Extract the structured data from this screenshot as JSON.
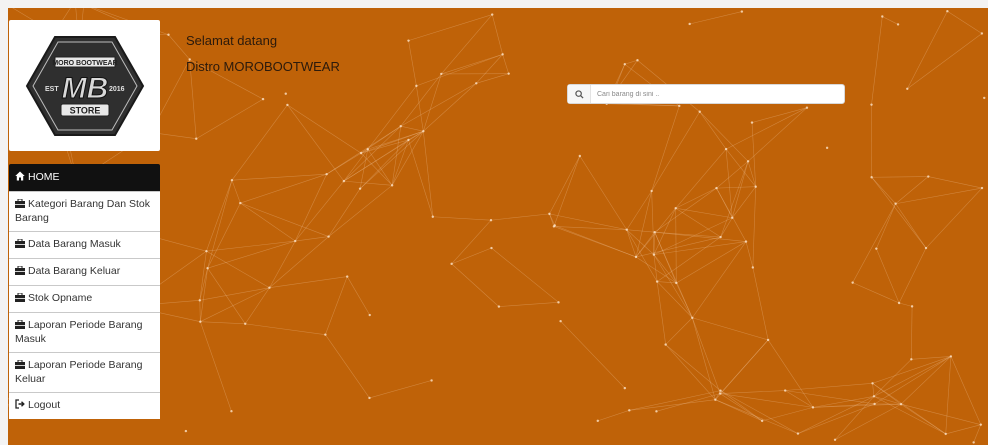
{
  "brand": {
    "logo_text_top": "MORO BOOTWEAR",
    "logo_text_mid": "MB",
    "logo_text_est": "EST",
    "logo_text_year": "2016",
    "logo_text_bottom": "STORE"
  },
  "header": {
    "greeting": "Selamat datang",
    "store_name": "Distro MOROBOOTWEAR"
  },
  "search": {
    "placeholder": "Cari barang di sini .."
  },
  "sidebar": {
    "items": [
      {
        "label": "HOME",
        "icon": "home-icon",
        "active": true
      },
      {
        "label": "Kategori Barang Dan Stok Barang",
        "icon": "briefcase-icon"
      },
      {
        "label": "Data Barang Masuk",
        "icon": "briefcase-icon"
      },
      {
        "label": "Data Barang Keluar",
        "icon": "briefcase-icon"
      },
      {
        "label": "Stok Opname",
        "icon": "briefcase-icon"
      },
      {
        "label": "Laporan Periode Barang Masuk",
        "icon": "briefcase-icon"
      },
      {
        "label": "Laporan Periode Barang Keluar",
        "icon": "briefcase-icon"
      },
      {
        "label": "Logout",
        "icon": "logout-icon"
      }
    ]
  },
  "colors": {
    "background": "#bf6208",
    "menu_active": "#111111",
    "menu_bg": "#ffffff"
  }
}
